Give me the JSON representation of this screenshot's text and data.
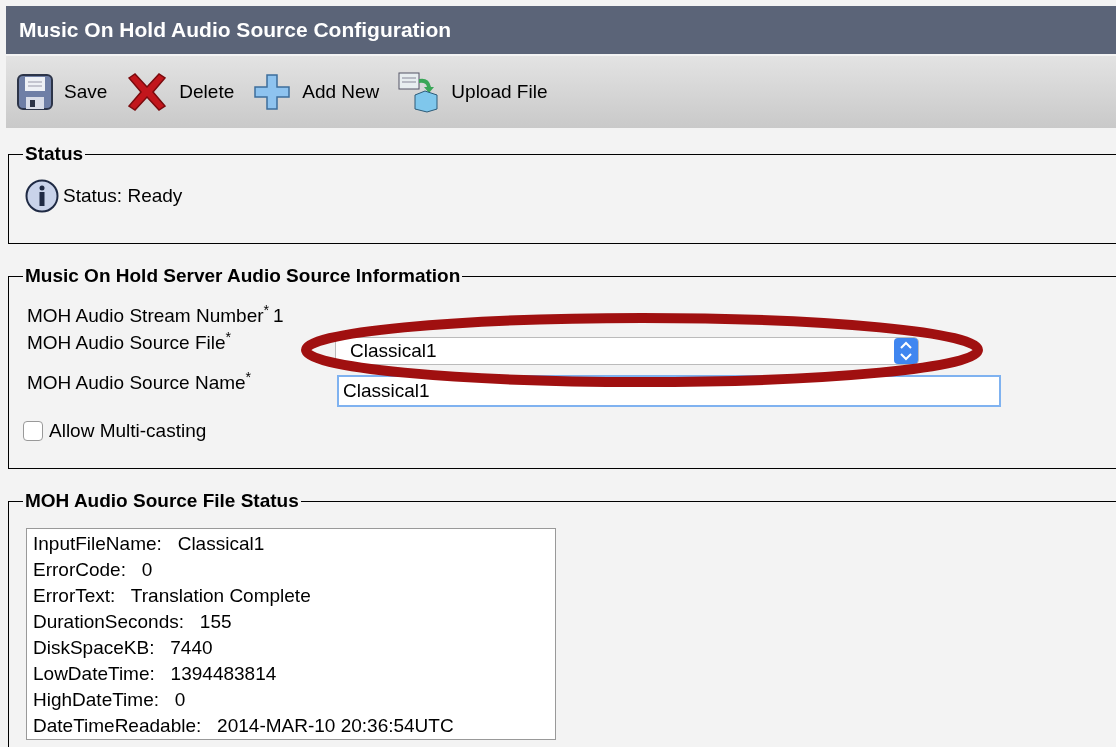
{
  "window": {
    "title": "Music On Hold Audio Source Configuration"
  },
  "toolbar": [
    {
      "kind": "save",
      "label": "Save"
    },
    {
      "kind": "delete",
      "label": "Delete"
    },
    {
      "kind": "add",
      "label": "Add New"
    },
    {
      "kind": "upload",
      "label": "Upload File"
    }
  ],
  "status": {
    "legend": "Status",
    "message": "Status: Ready"
  },
  "source_info": {
    "legend": "Music On Hold Server Audio Source Information",
    "stream_number": {
      "label": "MOH Audio Stream Number$^{*}$",
      "value": "1"
    },
    "source_file": {
      "label": "MOH Audio Source File$^{*}$",
      "value": "Classical1"
    },
    "source_name": {
      "label": "MOH Audio Source Name$^{*}$",
      "value": "Classical1"
    },
    "multicast": {
      "label": "Allow Multi-casting",
      "checked": false
    }
  },
  "file_status": {
    "legend": "MOH Audio Source File Status",
    "lines": [
      {
        "key": "InputFileName:",
        "value": "Classical1"
      },
      {
        "key": "ErrorCode:",
        "value": "0"
      },
      {
        "key": "ErrorText:",
        "value": "Translation Complete"
      },
      {
        "key": "DurationSeconds:",
        "value": "155"
      },
      {
        "key": "DiskSpaceKB:",
        "value": "7440"
      },
      {
        "key": "LowDateTime:",
        "value": "1394483814"
      },
      {
        "key": "HighDateTime:",
        "value": "0"
      },
      {
        "key": "DateTimeReadable:",
        "value": "2014-MAR-10 20:36:54UTC"
      }
    ]
  }
}
